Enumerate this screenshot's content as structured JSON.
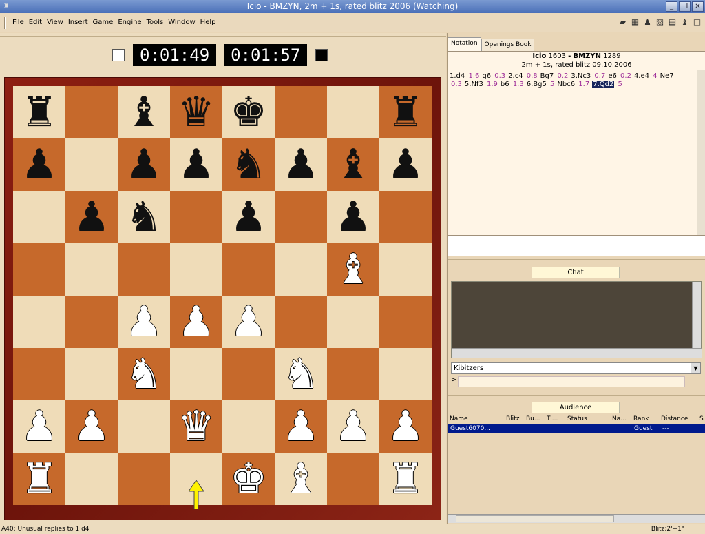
{
  "window": {
    "title": "Icio - BMZYN, 2m + 1s, rated blitz 2006 (Watching)",
    "buttons": [
      "_",
      "❐",
      "✕"
    ]
  },
  "menu": [
    "File",
    "Edit",
    "View",
    "Insert",
    "Game",
    "Engine",
    "Tools",
    "Window",
    "Help"
  ],
  "toolbar_icons": [
    "book-icon",
    "board-icon",
    "players-icon",
    "analysis-icon",
    "notation-icon",
    "piece-icon",
    "window-icon"
  ],
  "clocks": {
    "white": "0:01:49",
    "black": "0:01:57"
  },
  "board": {
    "ranks": [
      [
        "r",
        "",
        "b",
        "q",
        "k",
        "",
        "",
        "r"
      ],
      [
        "p",
        "",
        "p",
        "p",
        "n",
        "p",
        "b",
        "p"
      ],
      [
        "",
        "p",
        "n",
        "",
        "p",
        "",
        "p",
        ""
      ],
      [
        "",
        "",
        "",
        "",
        "",
        "",
        "B",
        ""
      ],
      [
        "",
        "",
        "P",
        "P",
        "P",
        "",
        "",
        ""
      ],
      [
        "",
        "",
        "N",
        "",
        "",
        "N",
        "",
        ""
      ],
      [
        "P",
        "P",
        "",
        "Q",
        "",
        "P",
        "P",
        "P"
      ],
      [
        "R",
        "",
        "",
        "",
        "K",
        "B",
        "",
        "R"
      ]
    ],
    "last_move_arrow": "d1-d2"
  },
  "notation": {
    "tabs": [
      "Notation",
      "Openings Book"
    ],
    "white_player": "Icio",
    "white_rating": "1603",
    "black_player": "BMZYN",
    "black_rating": "1289",
    "game_info": "2m + 1s, rated blitz 09.10.2006",
    "moves": [
      {
        "m": "1.d4",
        "e": "1.6"
      },
      {
        "m": "g6",
        "e": "0.3"
      },
      {
        "m": "2.c4",
        "e": "0.8"
      },
      {
        "m": "Bg7",
        "e": "0.2"
      },
      {
        "m": "3.Nc3",
        "e": "0.7"
      },
      {
        "m": "e6",
        "e": "0.2"
      },
      {
        "m": "4.e4",
        "e": "4"
      },
      {
        "m": "Ne7",
        "e": "0.3"
      },
      {
        "m": "5.Nf3",
        "e": "1.9"
      },
      {
        "m": "b6",
        "e": "1.3"
      },
      {
        "m": "6.Bg5",
        "e": "5"
      },
      {
        "m": "Nbc6",
        "e": "1.7"
      },
      {
        "m": "7.Qd2",
        "e": "5",
        "current": true
      }
    ]
  },
  "chat": {
    "header": "Chat",
    "channel": "Kibitzers",
    "prompt": ">"
  },
  "audience": {
    "header": "Audience",
    "columns": [
      "Name",
      "Blitz",
      "Bu...",
      "Ti...",
      "Status",
      "Na...",
      "Rank",
      "Distance",
      "S"
    ],
    "rows": [
      {
        "name": "Guest6070...",
        "rank": "Guest",
        "distance": "---"
      }
    ]
  },
  "status": {
    "left": "A40: Unusual replies to 1 d4",
    "right": "Blitz:2'+1\""
  }
}
